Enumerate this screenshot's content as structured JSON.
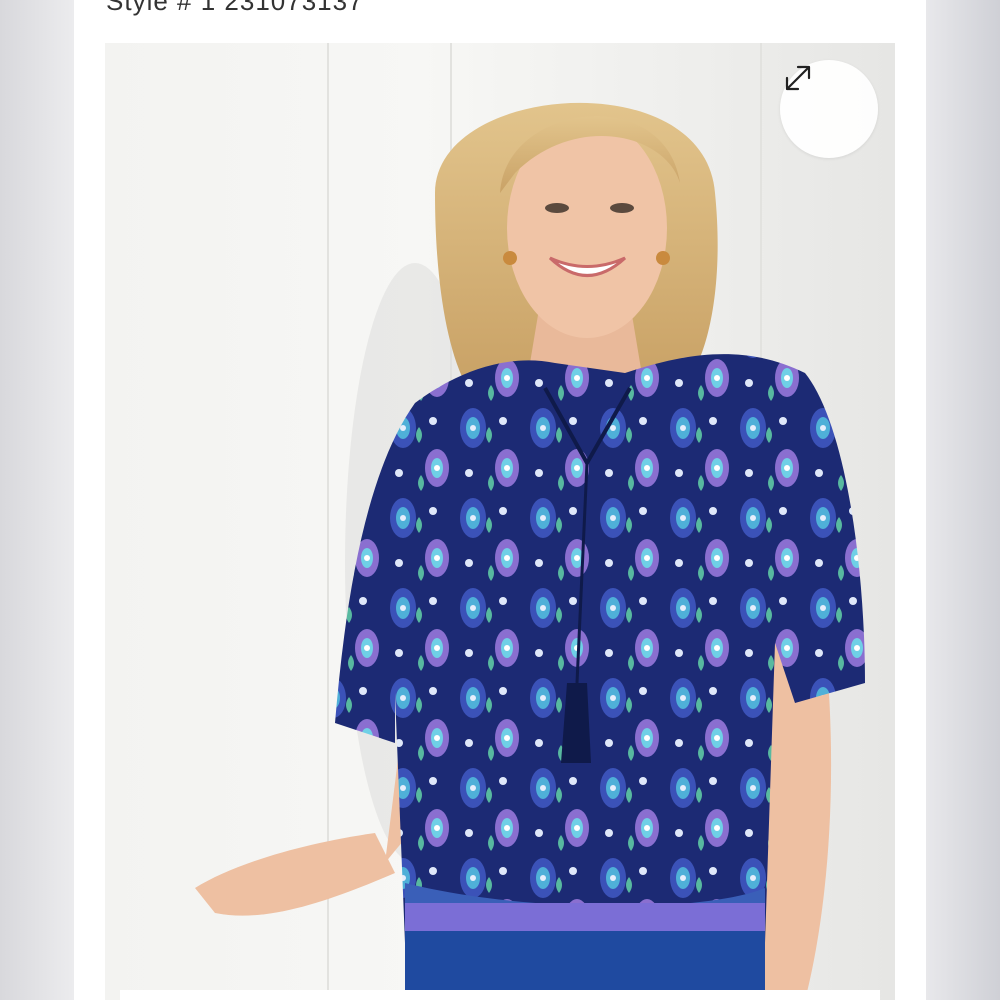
{
  "product": {
    "style_label": "Style # 1 231073137",
    "image_alt": "Woman wearing a blue paisley print peasant top with tassel tie neckline",
    "image_icon": "product-photo"
  },
  "controls": {
    "expand_icon": "expand-arrows-icon",
    "expand_label": "Expand image"
  },
  "colors": {
    "print_navy": "#1c2a74",
    "print_blue": "#3b52b8",
    "print_aqua": "#4fb0d8",
    "print_lilac": "#8a6fd0",
    "background": "#f4f4f2"
  }
}
